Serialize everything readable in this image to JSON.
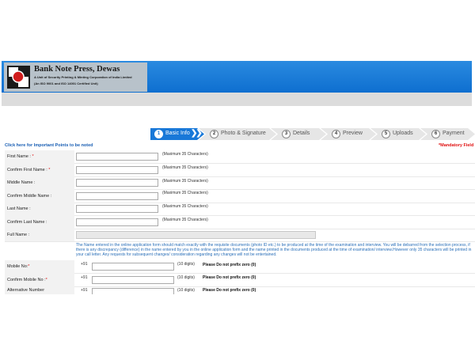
{
  "header": {
    "title": "Bank Note Press, Dewas",
    "subtitle1": "A Unit of Security Printing & Minting Corporation of India Limited",
    "subtitle2": "(An ISO 9001 and ISO 14001 Certified Unit)"
  },
  "colors": {
    "header_blue": "#1878d8",
    "required_red": "#e01010",
    "link_blue": "#1a5fb4"
  },
  "steps": [
    {
      "num": "1",
      "label": "Basic Info",
      "active": true
    },
    {
      "num": "2",
      "label": "Photo & Signature",
      "active": false
    },
    {
      "num": "3",
      "label": "Details",
      "active": false
    },
    {
      "num": "4",
      "label": "Preview",
      "active": false
    },
    {
      "num": "5",
      "label": "Uploads",
      "active": false
    },
    {
      "num": "6",
      "label": "Payment",
      "active": false
    }
  ],
  "important_link": "Click here for Important Points to be noted",
  "mandatory_text": "*Mandatory Field",
  "required_mark": "*",
  "form": {
    "first_name": {
      "label": "First Name :",
      "hint": "(Maximum 35 Characters)"
    },
    "confirm_first_name": {
      "label": "Confirm First Name :",
      "hint": "(Maximum 35 Characters)"
    },
    "middle_name": {
      "label": "Middle Name :",
      "hint": "(Maximum 35 Characters)"
    },
    "confirm_middle_name": {
      "label": "Confirm Middle Name :",
      "hint": "(Maximum 35 Characters)"
    },
    "last_name": {
      "label": "Last Name :",
      "hint": "(Maximum 35 Characters)"
    },
    "confirm_last_name": {
      "label": "Confirm Last Name :",
      "hint": "(Maximum 35 Characters)"
    },
    "full_name": {
      "label": "Full Name :"
    },
    "notice": "The Name entered in the online application form should match exactly with the requisite documents (photo ID etc.) to be produced at the time of the examination and interview. You will be debarred from the selection process, if there is any discrepancy (difference) in the name entered by you in the online application form and the name printed in the documents produced at the time of examination/ interview.However only 35 characters will be printed in your call letter. Any requests for subsequent changes/ consideration regarding any changes will not be entertained.",
    "mobile": {
      "label": "Mobile No:",
      "prefix": "+91",
      "hint": "(10 digits)",
      "warn": "Please Do not prefix zero (0)"
    },
    "confirm_mobile": {
      "label": "Confirm Mobile No :",
      "prefix": "+91",
      "hint": "(10 digits)",
      "warn": "Please Do not prefix zero (0)"
    },
    "alternative": {
      "label": "Alternative Number",
      "prefix": "+91",
      "hint": "(10 digits)",
      "warn": "Please Do not prefix zero (0)"
    }
  }
}
